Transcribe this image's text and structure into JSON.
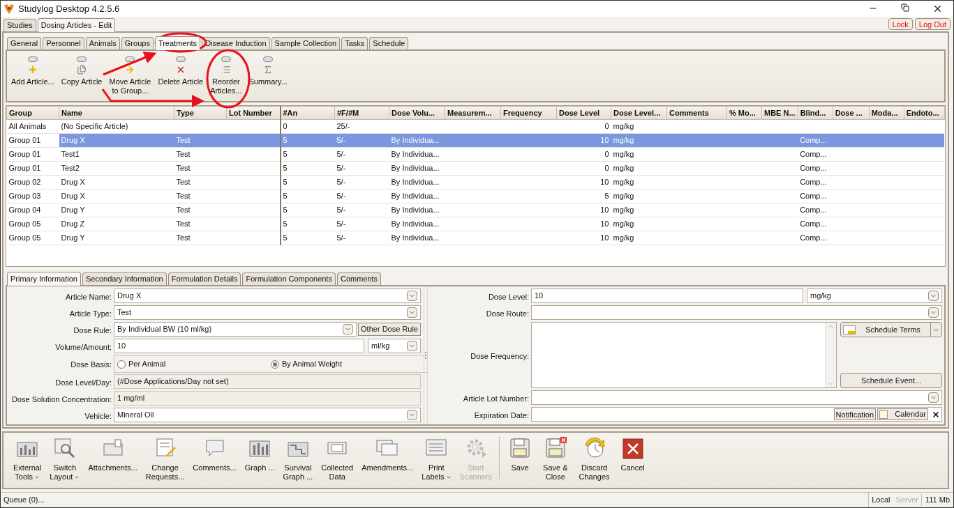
{
  "window": {
    "title": "Studylog Desktop 4.2.5.6"
  },
  "top_tabs": [
    {
      "label": "Studies",
      "selected": false
    },
    {
      "label": "Dosing Articles - Edit",
      "selected": true
    }
  ],
  "top_buttons": [
    "Lock",
    "Log Out"
  ],
  "section_tabs": [
    {
      "label": "General",
      "selected": false
    },
    {
      "label": "Personnel",
      "selected": false
    },
    {
      "label": "Animals",
      "selected": false
    },
    {
      "label": "Groups",
      "selected": false
    },
    {
      "label": "Treatments",
      "selected": true
    },
    {
      "label": "Disease Induction",
      "selected": false
    },
    {
      "label": "Sample Collection",
      "selected": false
    },
    {
      "label": "Tasks",
      "selected": false
    },
    {
      "label": "Schedule",
      "selected": false
    }
  ],
  "toolbar": [
    "Add Article...",
    "Copy Article",
    "Move Article\nto Group...",
    "Delete Article",
    "Reorder\nArticles...",
    "Summary..."
  ],
  "table": {
    "columns": [
      "Group",
      "Name",
      "Type",
      "Lot Number",
      "#An",
      "#F/#M",
      "Dose Volu...",
      "Measurem...",
      "Frequency",
      "Dose Level",
      "Dose Level...",
      "Comments",
      "% Mo...",
      "MBE N...",
      "Blind...",
      "Dose ...",
      "Moda...",
      "Endoto..."
    ],
    "rows": [
      {
        "selected": false,
        "cells": [
          "All Animals",
          "(No Specific Article)",
          "",
          "",
          "0",
          "25/-",
          "",
          "",
          "",
          "0",
          "mg/kg",
          "",
          "",
          "",
          "",
          "",
          "",
          ""
        ]
      },
      {
        "selected": true,
        "cells": [
          "Group 01",
          "Drug X",
          "Test",
          "",
          "5",
          "5/-",
          "By Individua...",
          "",
          "",
          "10",
          "mg/kg",
          "",
          "",
          "",
          "Comp...",
          "",
          "",
          ""
        ]
      },
      {
        "selected": false,
        "cells": [
          "Group 01",
          "Test1",
          "Test",
          "",
          "5",
          "5/-",
          "By Individua...",
          "",
          "",
          "0",
          "mg/kg",
          "",
          "",
          "",
          "Comp...",
          "",
          "",
          ""
        ]
      },
      {
        "selected": false,
        "cells": [
          "Group 01",
          "Test2",
          "Test",
          "",
          "5",
          "5/-",
          "By Individua...",
          "",
          "",
          "0",
          "mg/kg",
          "",
          "",
          "",
          "Comp...",
          "",
          "",
          ""
        ]
      },
      {
        "selected": false,
        "cells": [
          "Group 02",
          "Drug X",
          "Test",
          "",
          "5",
          "5/-",
          "By Individua...",
          "",
          "",
          "10",
          "mg/kg",
          "",
          "",
          "",
          "Comp...",
          "",
          "",
          ""
        ]
      },
      {
        "selected": false,
        "cells": [
          "Group 03",
          "Drug X",
          "Test",
          "",
          "5",
          "5/-",
          "By Individua...",
          "",
          "",
          "5",
          "mg/kg",
          "",
          "",
          "",
          "Comp...",
          "",
          "",
          ""
        ]
      },
      {
        "selected": false,
        "cells": [
          "Group 04",
          "Drug Y",
          "Test",
          "",
          "5",
          "5/-",
          "By Individua...",
          "",
          "",
          "10",
          "mg/kg",
          "",
          "",
          "",
          "Comp...",
          "",
          "",
          ""
        ]
      },
      {
        "selected": false,
        "cells": [
          "Group 05",
          "Drug Z",
          "Test",
          "",
          "5",
          "5/-",
          "By Individua...",
          "",
          "",
          "10",
          "mg/kg",
          "",
          "",
          "",
          "Comp...",
          "",
          "",
          ""
        ]
      },
      {
        "selected": false,
        "cells": [
          "Group 05",
          "Drug Y",
          "Test",
          "",
          "5",
          "5/-",
          "By Individua...",
          "",
          "",
          "10",
          "mg/kg",
          "",
          "",
          "",
          "Comp...",
          "",
          "",
          ""
        ]
      }
    ]
  },
  "detail_tabs": [
    {
      "label": "Primary Information",
      "selected": true
    },
    {
      "label": "Secondary Information",
      "selected": false
    },
    {
      "label": "Formulation Details",
      "selected": false
    },
    {
      "label": "Formulation Components",
      "selected": false
    },
    {
      "label": "Comments",
      "selected": false
    }
  ],
  "left_fields": [
    {
      "kind": "combo",
      "label": "Article Name:",
      "value": "Drug X"
    },
    {
      "kind": "combo",
      "label": "Article Type:",
      "value": "Test"
    },
    {
      "kind": "combo_button",
      "label": "Dose Rule:",
      "value": "By Individual BW (10 ml/kg)",
      "button": "Other Dose Rule"
    },
    {
      "kind": "text_unit",
      "label": "Volume/Amount:",
      "value": "10",
      "unit": "ml/kg"
    },
    {
      "kind": "radio",
      "label": "Dose Basis:",
      "options": [
        {
          "label": "Per Animal",
          "selected": false
        },
        {
          "label": "By Animal Weight",
          "selected": true
        }
      ]
    },
    {
      "kind": "readonly",
      "label": "Dose Level/Day:",
      "value": "(#Dose Applications/Day not set)"
    },
    {
      "kind": "readonly",
      "label": "Dose Solution Concentration:",
      "value": "1 mg/ml"
    },
    {
      "kind": "combo",
      "label": "Vehicle:",
      "value": "Mineral Oil"
    }
  ],
  "right_fields": [
    {
      "kind": "text_unit",
      "label": "Dose Level:",
      "value": "10",
      "unit": "mg/kg"
    },
    {
      "kind": "combo",
      "label": "Dose Route:"
    },
    {
      "kind": "textarea",
      "label": "Dose Frequency:",
      "buttons": [
        "Schedule Terms",
        "Schedule Event..."
      ]
    },
    {
      "kind": "combo",
      "label": "Article Lot Number:"
    },
    {
      "kind": "date",
      "label": "Expiration Date:",
      "buttons": [
        "Notification",
        "Calendar"
      ]
    }
  ],
  "bottom_toolbar": [
    {
      "label": "External\nTools",
      "dropdown": true,
      "disabled": false
    },
    {
      "label": "Switch\nLayout",
      "dropdown": true,
      "disabled": false
    },
    {
      "label": "Attachments...",
      "dropdown": false,
      "disabled": false
    },
    {
      "label": "Change\nRequests...",
      "dropdown": false,
      "disabled": false
    },
    {
      "label": "Comments...",
      "dropdown": false,
      "disabled": false
    },
    {
      "label": "Graph ...",
      "dropdown": false,
      "disabled": false
    },
    {
      "label": "Survival\nGraph ...",
      "dropdown": false,
      "disabled": false
    },
    {
      "label": "Collected\nData",
      "dropdown": false,
      "disabled": false
    },
    {
      "label": "Amendments...",
      "dropdown": false,
      "disabled": false
    },
    {
      "label": "Print\nLabels",
      "dropdown": true,
      "disabled": false
    },
    {
      "label": "Start\nScanners",
      "dropdown": false,
      "disabled": true
    }
  ],
  "action_buttons": [
    "Save",
    "Save &\nClose",
    "Discard\nChanges",
    "Cancel"
  ],
  "status_bar": {
    "queue": "Queue (0)...",
    "local": "Local",
    "server": "Server",
    "memory": "111 Mb"
  }
}
